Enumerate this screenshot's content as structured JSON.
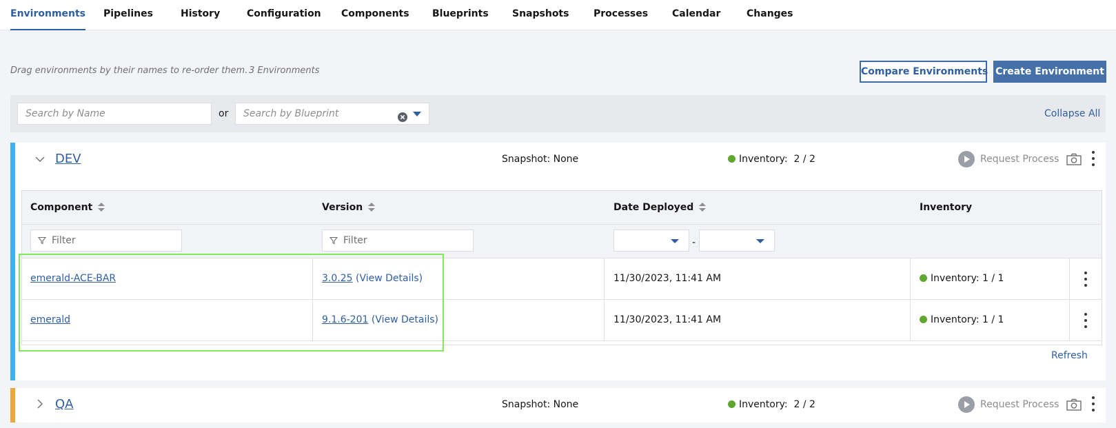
{
  "tabs": [
    {
      "label": "Environments",
      "active": true
    },
    {
      "label": "Pipelines"
    },
    {
      "label": "History"
    },
    {
      "label": "Configuration"
    },
    {
      "label": "Components"
    },
    {
      "label": "Blueprints"
    },
    {
      "label": "Snapshots"
    },
    {
      "label": "Processes"
    },
    {
      "label": "Calendar"
    },
    {
      "label": "Changes"
    }
  ],
  "toolbar": {
    "hint": "Drag environments by their names to re-order them.",
    "count": "3 Environments",
    "compare_label": "Compare Environments",
    "create_label": "Create Environment"
  },
  "search": {
    "name_placeholder": "Search by Name",
    "or_label": "or",
    "blueprint_placeholder": "Search by Blueprint",
    "collapse_all": "Collapse All"
  },
  "environments": [
    {
      "name": "DEV",
      "expanded": true,
      "color": "#3fb0ef",
      "snapshot": "Snapshot: None",
      "inventory_label": "Inventory:",
      "inventory_value": "2 / 2",
      "request_label": "Request Process"
    },
    {
      "name": "QA",
      "expanded": false,
      "color": "#e8a83b",
      "snapshot": "Snapshot: None",
      "inventory_label": "Inventory:",
      "inventory_value": "2 / 2",
      "request_label": "Request Process"
    }
  ],
  "table": {
    "headers": {
      "component": "Component",
      "version": "Version",
      "date": "Date Deployed",
      "inventory": "Inventory"
    },
    "filter_placeholder": "Filter",
    "date_separator": "-",
    "rows": [
      {
        "component": "emerald-ACE-BAR",
        "version": "3.0.25",
        "details": "(View Details)",
        "date": "11/30/2023, 11:41 AM",
        "inventory": "Inventory: 1 / 1"
      },
      {
        "component": "emerald",
        "version": "9.1.6-201",
        "details": "(View Details)",
        "date": "11/30/2023, 11:41 AM",
        "inventory": "Inventory: 1 / 1"
      }
    ],
    "refresh_label": "Refresh"
  },
  "colors": {
    "accent": "#2f5fa0",
    "status_ok": "#60a72f",
    "highlight": "#7ee85a"
  }
}
